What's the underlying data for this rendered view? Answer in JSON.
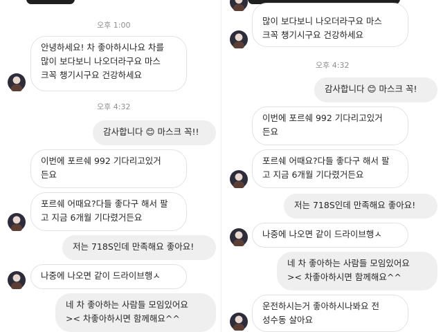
{
  "left": {
    "time1": "오후 1:00",
    "msg1": "안녕하세요! 차 좋아하시나요 차를\n많이 보다보니 나오더라구요 마스\n크꼭 챙기시구요 건강하세요",
    "time2": "오후 4:32",
    "msg2": "감사합니다 😊 마스크 꼭!!",
    "msg3": "이번에 포르쉐 992 기다리고있거\n든요",
    "msg4": "포르쉐 어때요?다들 좋다구 해서 팔\n고 지금 6개월 기다렸거든요",
    "msg5": "저는 718S인데 만족해요 좋아요!",
    "msg6": "나중에 나오면 같이 드라이브행ㅅ",
    "msg7": "네 차 좋아하는 사람들 모임있어요\n>< 차좋아하시면 함께해요^^"
  },
  "right": {
    "msg1": "많이 보다보니 나오더라구요 마스\n크꼭 챙기시구요 건강하세요",
    "time2": "오후 4:32",
    "msg2": "감사합니다 😊 마스크 꼭!",
    "msg3": "이번에 포르쉐 992 기다리고있거\n든요",
    "msg4": "포르쉐 어때요?다들 좋다구 해서 팔\n고 지금 6개월 기다렸거든요",
    "msg5": "저는 718S인데 만족해요 좋아요!",
    "msg6": "나중에 나오면 같이 드라이브행ㅅ",
    "msg7": "네 차 좋아하는 사람들 모임있어요\n>< 차좋아하시면 함께해요^^",
    "msg8": "운전하시는거 좋아하시나봐요 전\n성수동 살아요"
  }
}
